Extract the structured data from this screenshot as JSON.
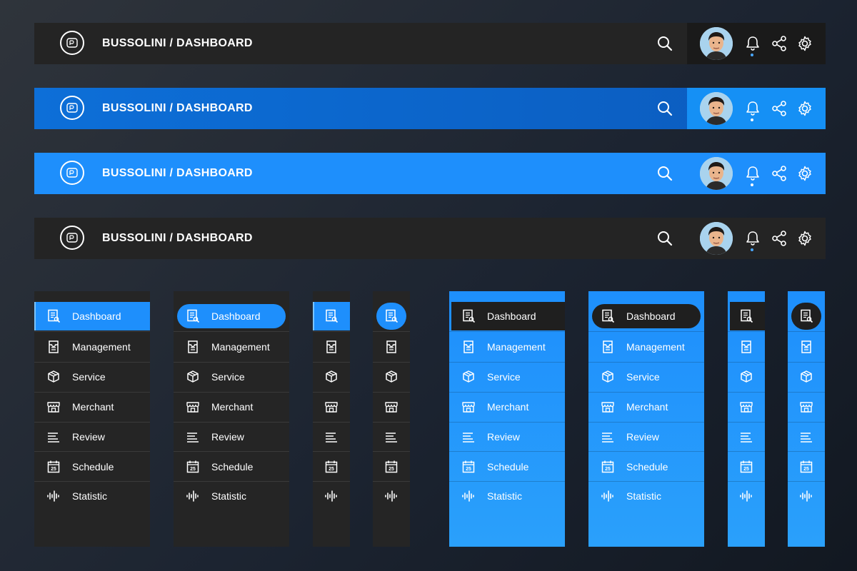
{
  "header": {
    "title": "BUSSOLINI / DASHBOARD"
  },
  "nav": {
    "items": [
      {
        "label": "Dashboard",
        "icon": "dashboard-icon"
      },
      {
        "label": "Management",
        "icon": "management-icon"
      },
      {
        "label": "Service",
        "icon": "service-icon"
      },
      {
        "label": "Merchant",
        "icon": "merchant-icon"
      },
      {
        "label": "Review",
        "icon": "review-icon"
      },
      {
        "label": "Schedule",
        "icon": "schedule-icon"
      },
      {
        "label": "Statistic",
        "icon": "statistic-icon"
      }
    ],
    "schedule_day": "25",
    "active_index": 0
  },
  "colors": {
    "dark_bg": "#242424",
    "blue_bg": "#1e8ffc",
    "dark_blue": "#0d6fd8",
    "accent": "#1e8ffc",
    "blue_accent_dark": "#1f1f1f"
  }
}
